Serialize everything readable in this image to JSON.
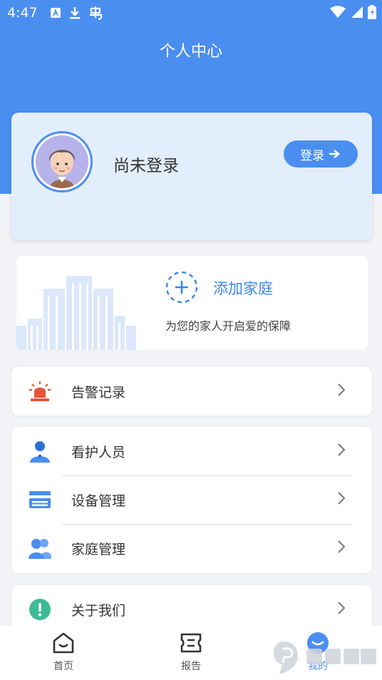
{
  "status_bar": {
    "time": "4:47"
  },
  "header": {
    "title": "个人中心"
  },
  "profile": {
    "name": "尚未登录",
    "login_label": "登录"
  },
  "family": {
    "add_label": "添加家庭",
    "description": "为您的家人开启爱的保障"
  },
  "menu_groups": [
    {
      "items": [
        {
          "label": "告警记录",
          "icon": "alarm-siren-icon"
        }
      ]
    },
    {
      "items": [
        {
          "label": "看护人员",
          "icon": "caregiver-person-icon"
        },
        {
          "label": "设备管理",
          "icon": "device-card-icon"
        },
        {
          "label": "家庭管理",
          "icon": "family-group-icon"
        }
      ]
    },
    {
      "items": [
        {
          "label": "关于我们",
          "icon": "info-exclamation-icon"
        }
      ]
    }
  ],
  "bottom_nav": {
    "items": [
      {
        "label": "首页",
        "icon": "home-icon",
        "active": false
      },
      {
        "label": "报告",
        "icon": "report-ticket-icon",
        "active": false
      },
      {
        "label": "我的",
        "icon": "profile-icon",
        "active": true
      }
    ]
  },
  "colors": {
    "primary": "#4a8ef0",
    "alarm": "#e8533a",
    "about": "#3dbb94",
    "background": "#f2f3f6"
  }
}
